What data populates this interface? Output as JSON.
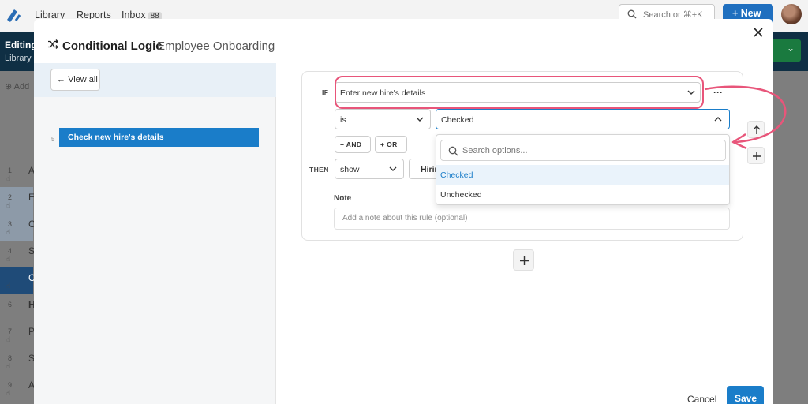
{
  "app": {
    "nav": [
      "Library",
      "Reports",
      "Inbox"
    ],
    "inbox_count": "88",
    "search_placeholder": "Search or ⌘+K",
    "new_button": "+ New",
    "editing_label": "Editing",
    "library_label": "Library",
    "add_label": "Add",
    "rows": [
      {
        "num": "1",
        "letter": "A"
      },
      {
        "num": "2",
        "letter": "E"
      },
      {
        "num": "3",
        "letter": "C"
      },
      {
        "num": "4",
        "letter": "S"
      },
      {
        "num": "",
        "letter": "C"
      },
      {
        "num": "6",
        "letter": "H"
      },
      {
        "num": "7",
        "letter": "P"
      },
      {
        "num": "8",
        "letter": "S"
      },
      {
        "num": "9",
        "letter": "A"
      }
    ]
  },
  "modal": {
    "title": "Conditional Logic",
    "subtitle": "Employee Onboarding",
    "view_all": "View all",
    "rule_number": "5",
    "rule_name": "Check new hire's details",
    "if_label": "IF",
    "then_label": "THEN",
    "field_value": "Enter new hire's details",
    "operator_value": "is",
    "value_selected": "Checked",
    "and_label": "+ AND",
    "or_label": "+ OR",
    "action_value": "show",
    "target_value": "Hirin",
    "note_label": "Note",
    "note_placeholder": "Add a note about this rule (optional)",
    "dropdown": {
      "search_placeholder": "Search options...",
      "options": [
        "Checked",
        "Unchecked"
      ],
      "selected_index": 0
    },
    "cancel": "Cancel",
    "save": "Save"
  },
  "colors": {
    "accent": "#1a7dc9",
    "annotation": "#e8557a",
    "header_bar": "#0f2f44",
    "new_button": "#1f6fbf"
  }
}
